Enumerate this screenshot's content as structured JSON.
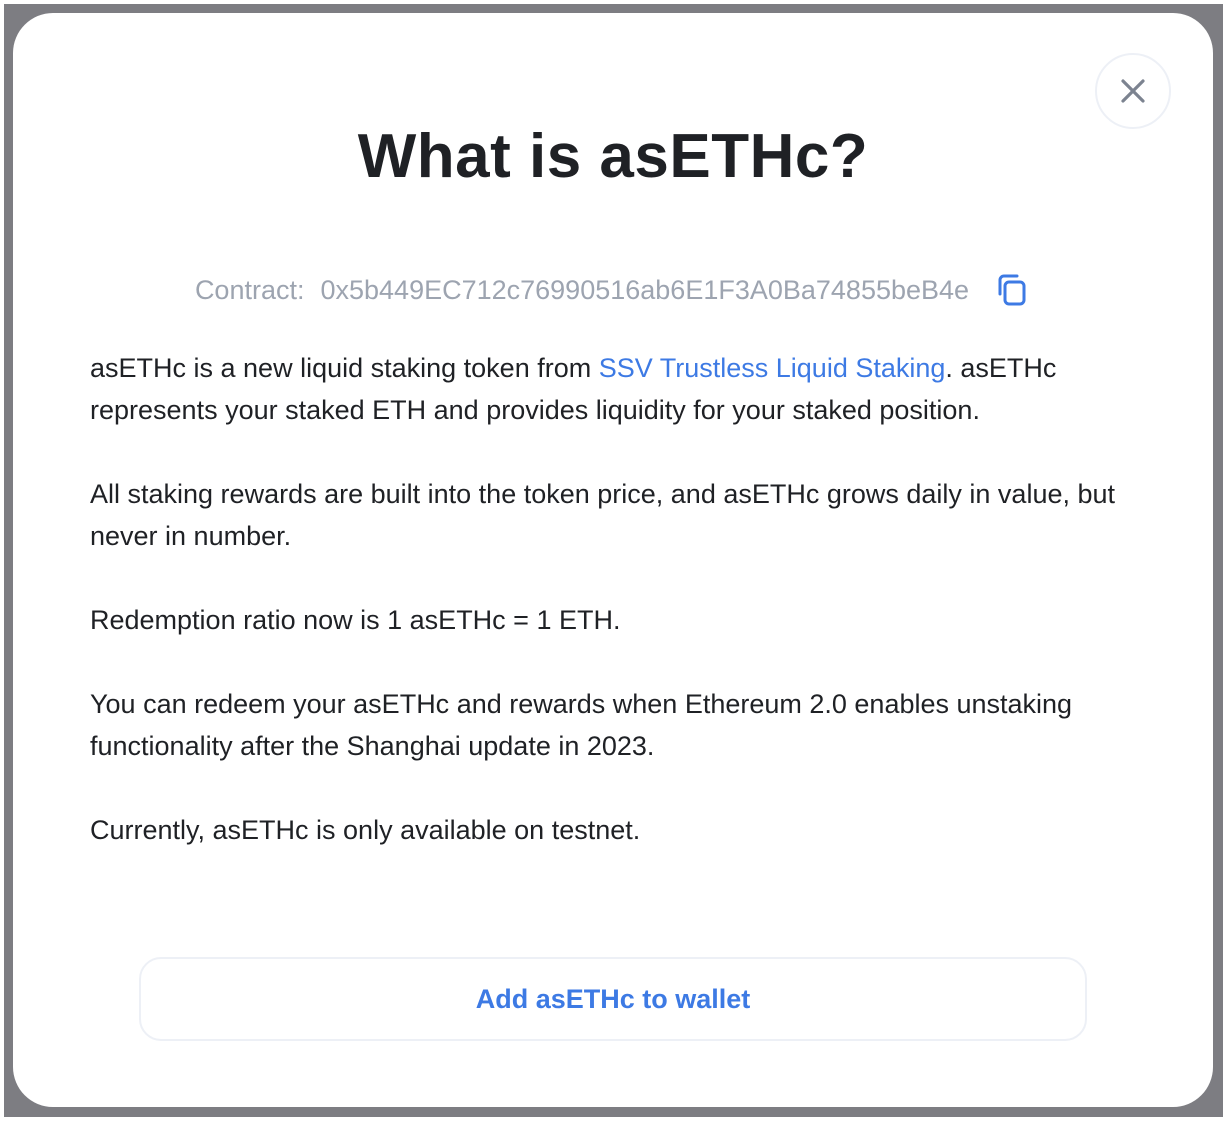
{
  "modal": {
    "title": "What is asETHc?",
    "close_icon": "close-icon",
    "contract": {
      "label": "Contract:",
      "address": "0x5b449EC712c76990516ab6E1F3A0Ba74855beB4e",
      "copy_icon": "copy-icon"
    },
    "paragraphs": {
      "p1_before_link": "asETHc is a new liquid staking token from ",
      "p1_link": "SSV Trustless Liquid Staking",
      "p1_after_link": ". asETHc represents your staked ETH and provides liquidity for your staked position.",
      "p2": "All staking rewards are built into the token price, and asETHc grows daily in value, but never in number.",
      "p3": "Redemption ratio now is 1 asETHc = 1 ETH.",
      "p4": "You can redeem your asETHc and rewards when Ethereum 2.0 enables unstaking functionality after the Shanghai update in 2023.",
      "p5": "Currently, asETHc is only available on testnet."
    },
    "add_wallet_button": "Add asETHc to wallet"
  },
  "colors": {
    "accent": "#3d7ae4",
    "text": "#1f2125",
    "muted": "#9da4b0",
    "border": "#edf0f6",
    "backdrop": "#7d7d82"
  }
}
